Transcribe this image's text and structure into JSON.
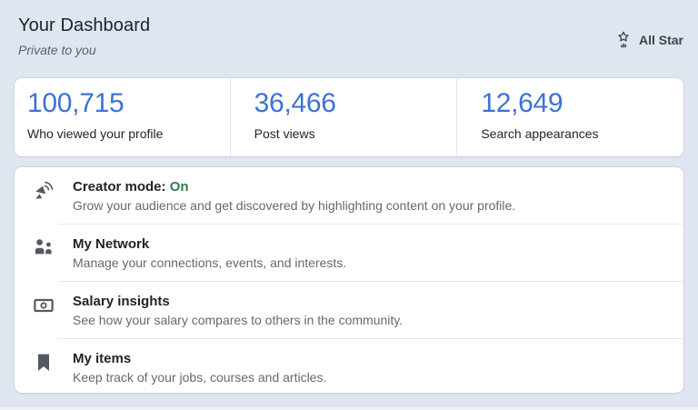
{
  "colors": {
    "background": "#dfe6f0",
    "card": "#ffffff",
    "accent_blue": "#3d73d2",
    "status_green": "#2f7d4f",
    "icon_gray": "#54595f"
  },
  "header": {
    "title": "Your Dashboard",
    "subtitle": "Private to you",
    "badge": {
      "icon": "all-star-icon",
      "label": "All Star"
    }
  },
  "stats": {
    "items": [
      {
        "value": "100,715",
        "label": "Who viewed your profile"
      },
      {
        "value": "36,466",
        "label": "Post views"
      },
      {
        "value": "12,649",
        "label": "Search appearances"
      }
    ]
  },
  "list": {
    "items": [
      {
        "icon": "broadcast-icon",
        "title": "Creator mode:",
        "status": "On",
        "description": "Grow your audience and get discovered by highlighting content on your profile."
      },
      {
        "icon": "people-icon",
        "title": "My Network",
        "description": "Manage your connections, events, and interests."
      },
      {
        "icon": "banknote-icon",
        "title": "Salary insights",
        "description": "See how your salary compares to others in the community."
      },
      {
        "icon": "bookmark-icon",
        "title": "My items",
        "description": "Keep track of your jobs, courses and articles."
      }
    ]
  }
}
